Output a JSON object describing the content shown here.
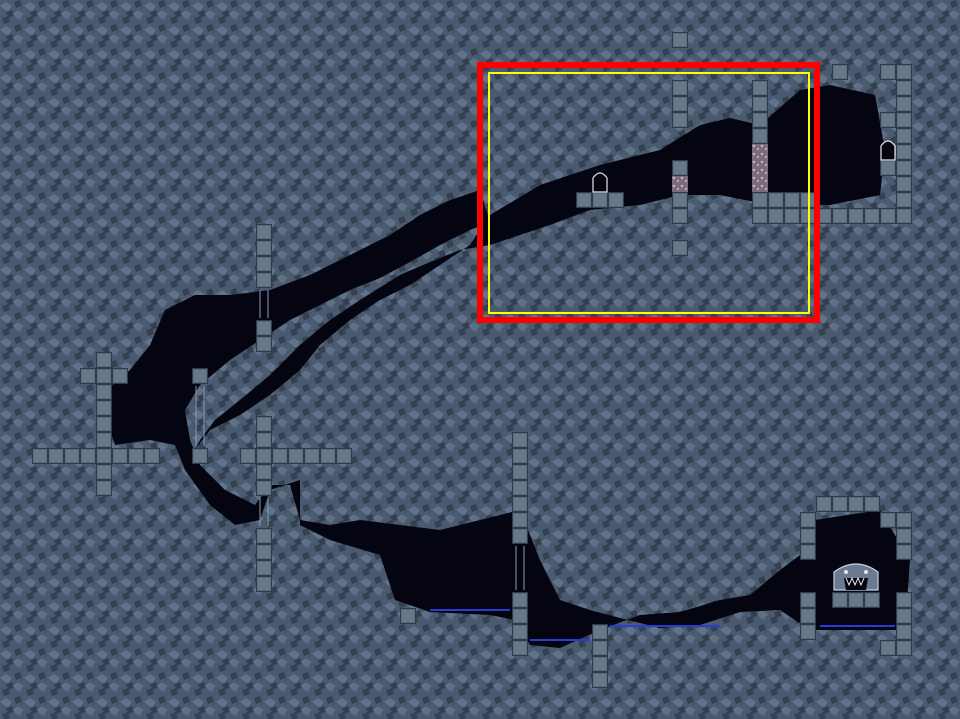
{
  "map": {
    "view": "cave-level-overview",
    "colors": {
      "rock": "#4a5a70",
      "rock_dark": "#34414f",
      "rock_light": "#6b7d94",
      "cave_void": "#050512",
      "block": "#5a6b80",
      "block_edge": "#2f3a47",
      "breakable_block": "#8a7a86",
      "water": "#2a3bd6",
      "selection_outer": "#ff0000",
      "selection_inner": "#ffff00"
    },
    "objects": [
      {
        "name": "door",
        "icon": "door-icon"
      },
      {
        "name": "door",
        "icon": "door-icon"
      },
      {
        "name": "breakable-star-block",
        "icon": "star-block-icon"
      },
      {
        "name": "breakable-star-block-column",
        "icon": "star-block-icon"
      },
      {
        "name": "boss-skull-creature",
        "icon": "skull-creature-icon"
      }
    ],
    "selection": {
      "outer": "viewport-frame-red",
      "inner": "camera-frame-yellow"
    }
  }
}
